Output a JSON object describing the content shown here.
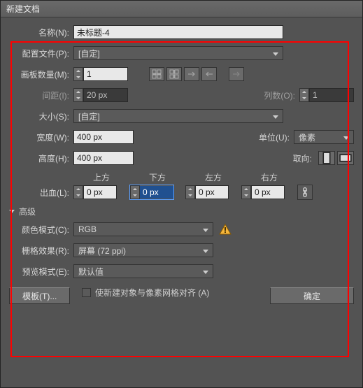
{
  "titlebar": "新建文档",
  "name": {
    "label": "名称(N):",
    "value": "未标题-4"
  },
  "profile": {
    "label": "配置文件(P):",
    "value": "[自定]"
  },
  "artboards": {
    "count_label": "画板数量(M):",
    "count": "1",
    "spacing_label": "间距(I):",
    "spacing": "20 px",
    "cols_label": "列数(O):",
    "cols": "1"
  },
  "size": {
    "label": "大小(S):",
    "value": "[自定]"
  },
  "width": {
    "label": "宽度(W):",
    "value": "400 px"
  },
  "height": {
    "label": "高度(H):",
    "value": "400 px"
  },
  "units": {
    "label": "单位(U):",
    "value": "像素"
  },
  "orient": {
    "label": "取向:"
  },
  "bleed": {
    "label": "出血(L):",
    "top_label": "上方",
    "top": "0 px",
    "bottom_label": "下方",
    "bottom": "0 px",
    "left_label": "左方",
    "left": "0 px",
    "right_label": "右方",
    "right": "0 px"
  },
  "advanced": {
    "header": "高级"
  },
  "colormode": {
    "label": "颜色模式(C):",
    "value": "RGB"
  },
  "raster": {
    "label": "栅格效果(R):",
    "value": "屏幕 (72 ppi)"
  },
  "preview": {
    "label": "预览模式(E):",
    "value": "默认值"
  },
  "align": {
    "label": "使新建对象与像素网格对齐 (A)"
  },
  "buttons": {
    "template": "模板(T)...",
    "ok": "确定"
  }
}
